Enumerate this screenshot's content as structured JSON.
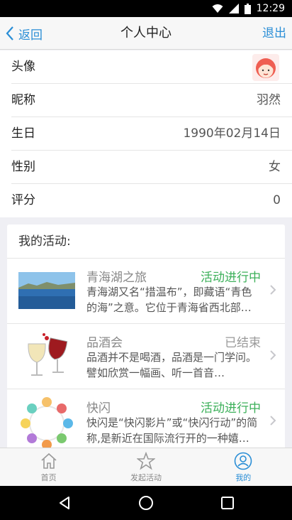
{
  "status_bar": {
    "time": "12:29"
  },
  "nav": {
    "back_label": "返回",
    "title": "个人中心",
    "logout_label": "退出"
  },
  "profile": {
    "avatar_label": "头像",
    "rows": [
      {
        "label": "昵称",
        "value": "羽然"
      },
      {
        "label": "生日",
        "value": "1990年02月14日"
      },
      {
        "label": "性别",
        "value": "女"
      },
      {
        "label": "评分",
        "value": "0"
      }
    ]
  },
  "activities": {
    "header": "我的活动:",
    "items": [
      {
        "title": "青海湖之旅",
        "status": "活动进行中",
        "desc": "青海湖又名“措温布”，即藏语“青色的海”之意。它位于青海省西北部…"
      },
      {
        "title": "品酒会",
        "status": "已结束",
        "desc": "品酒并不是喝酒，品酒是一门学问。譬如欣赏一幅画、听一首音…"
      },
      {
        "title": "快闪",
        "status": "活动进行中",
        "desc": "快闪是“快闪影片”或“快闪行动”的简称,是新近在国际流行开的一种嬉…"
      }
    ]
  },
  "tabs": [
    {
      "label": "首页",
      "icon": "home-icon"
    },
    {
      "label": "发起活动",
      "icon": "star-icon"
    },
    {
      "label": "我的",
      "icon": "user-icon"
    }
  ],
  "colors": {
    "accent": "#2a8ed6",
    "active_status": "#3cb05a",
    "ended_status": "#999999"
  }
}
